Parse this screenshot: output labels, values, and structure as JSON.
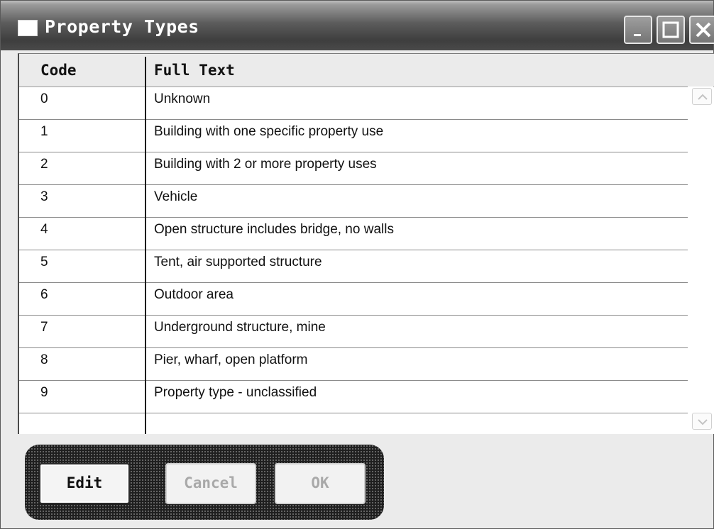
{
  "window": {
    "title": "Property Types",
    "controls": [
      "minimize",
      "maximize",
      "close"
    ]
  },
  "table": {
    "columns": [
      "Code",
      "Full Text"
    ],
    "rows": [
      {
        "code": "0",
        "text": "Unknown"
      },
      {
        "code": "1",
        "text": "Building with one specific property use"
      },
      {
        "code": "2",
        "text": "Building with 2 or more property uses"
      },
      {
        "code": "3",
        "text": "Vehicle"
      },
      {
        "code": "4",
        "text": "Open structure includes bridge, no walls"
      },
      {
        "code": "5",
        "text": "Tent, air supported structure"
      },
      {
        "code": "6",
        "text": "Outdoor area"
      },
      {
        "code": "7",
        "text": "Underground structure, mine"
      },
      {
        "code": "8",
        "text": "Pier, wharf, open platform"
      },
      {
        "code": "9",
        "text": "Property type - unclassified"
      },
      {
        "code": "",
        "text": ""
      }
    ]
  },
  "buttons": {
    "edit": {
      "label": "Edit",
      "enabled": true
    },
    "cancel": {
      "label": "Cancel",
      "enabled": false
    },
    "ok": {
      "label": "OK",
      "enabled": false
    }
  },
  "icons": {
    "window_icon": "window-icon",
    "minimize": "minimize-icon",
    "maximize": "maximize-icon",
    "close": "close-icon",
    "scroll_up": "chevron-up-icon",
    "scroll_down": "chevron-down-icon"
  }
}
